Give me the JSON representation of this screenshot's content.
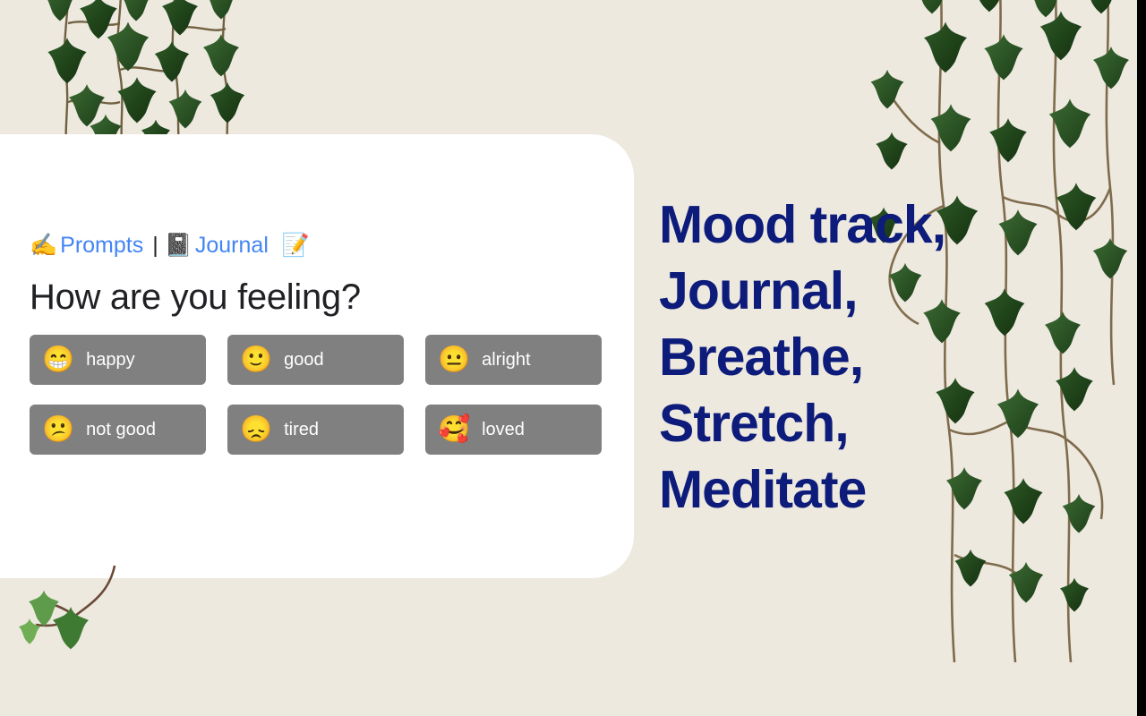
{
  "background_color": "#EDE9DF",
  "card": {
    "background_color": "#FFFFFF",
    "breadcrumb": {
      "writing_hand_icon": "✍️",
      "prompts_label": "Prompts",
      "separator": "|",
      "notebook_icon": "📓",
      "journal_label": "Journal",
      "memo_icon": "📝",
      "link_color": "#4285F4"
    },
    "question": "How are you feeling?",
    "moods": [
      {
        "emoji": "😁",
        "label": "happy"
      },
      {
        "emoji": "🙂",
        "label": "good"
      },
      {
        "emoji": "😐",
        "label": "alright"
      },
      {
        "emoji": "😕",
        "label": "not good"
      },
      {
        "emoji": "😞",
        "label": "tired"
      },
      {
        "emoji": "🥰",
        "label": "loved"
      }
    ],
    "mood_button_color": "#808080",
    "mood_label_color": "#FFFFFF"
  },
  "headline": {
    "color": "#0D1B7A",
    "lines": [
      "Mood track,",
      "Journal,",
      "Breathe,",
      "Stretch,",
      "Meditate"
    ]
  },
  "decoration": {
    "ivy_top_left": "hanging-ivy-vine",
    "ivy_right": "hanging-ivy-vine",
    "ivy_bottom_left": "ivy-sprig",
    "right_edge_strip_color": "#000000"
  }
}
